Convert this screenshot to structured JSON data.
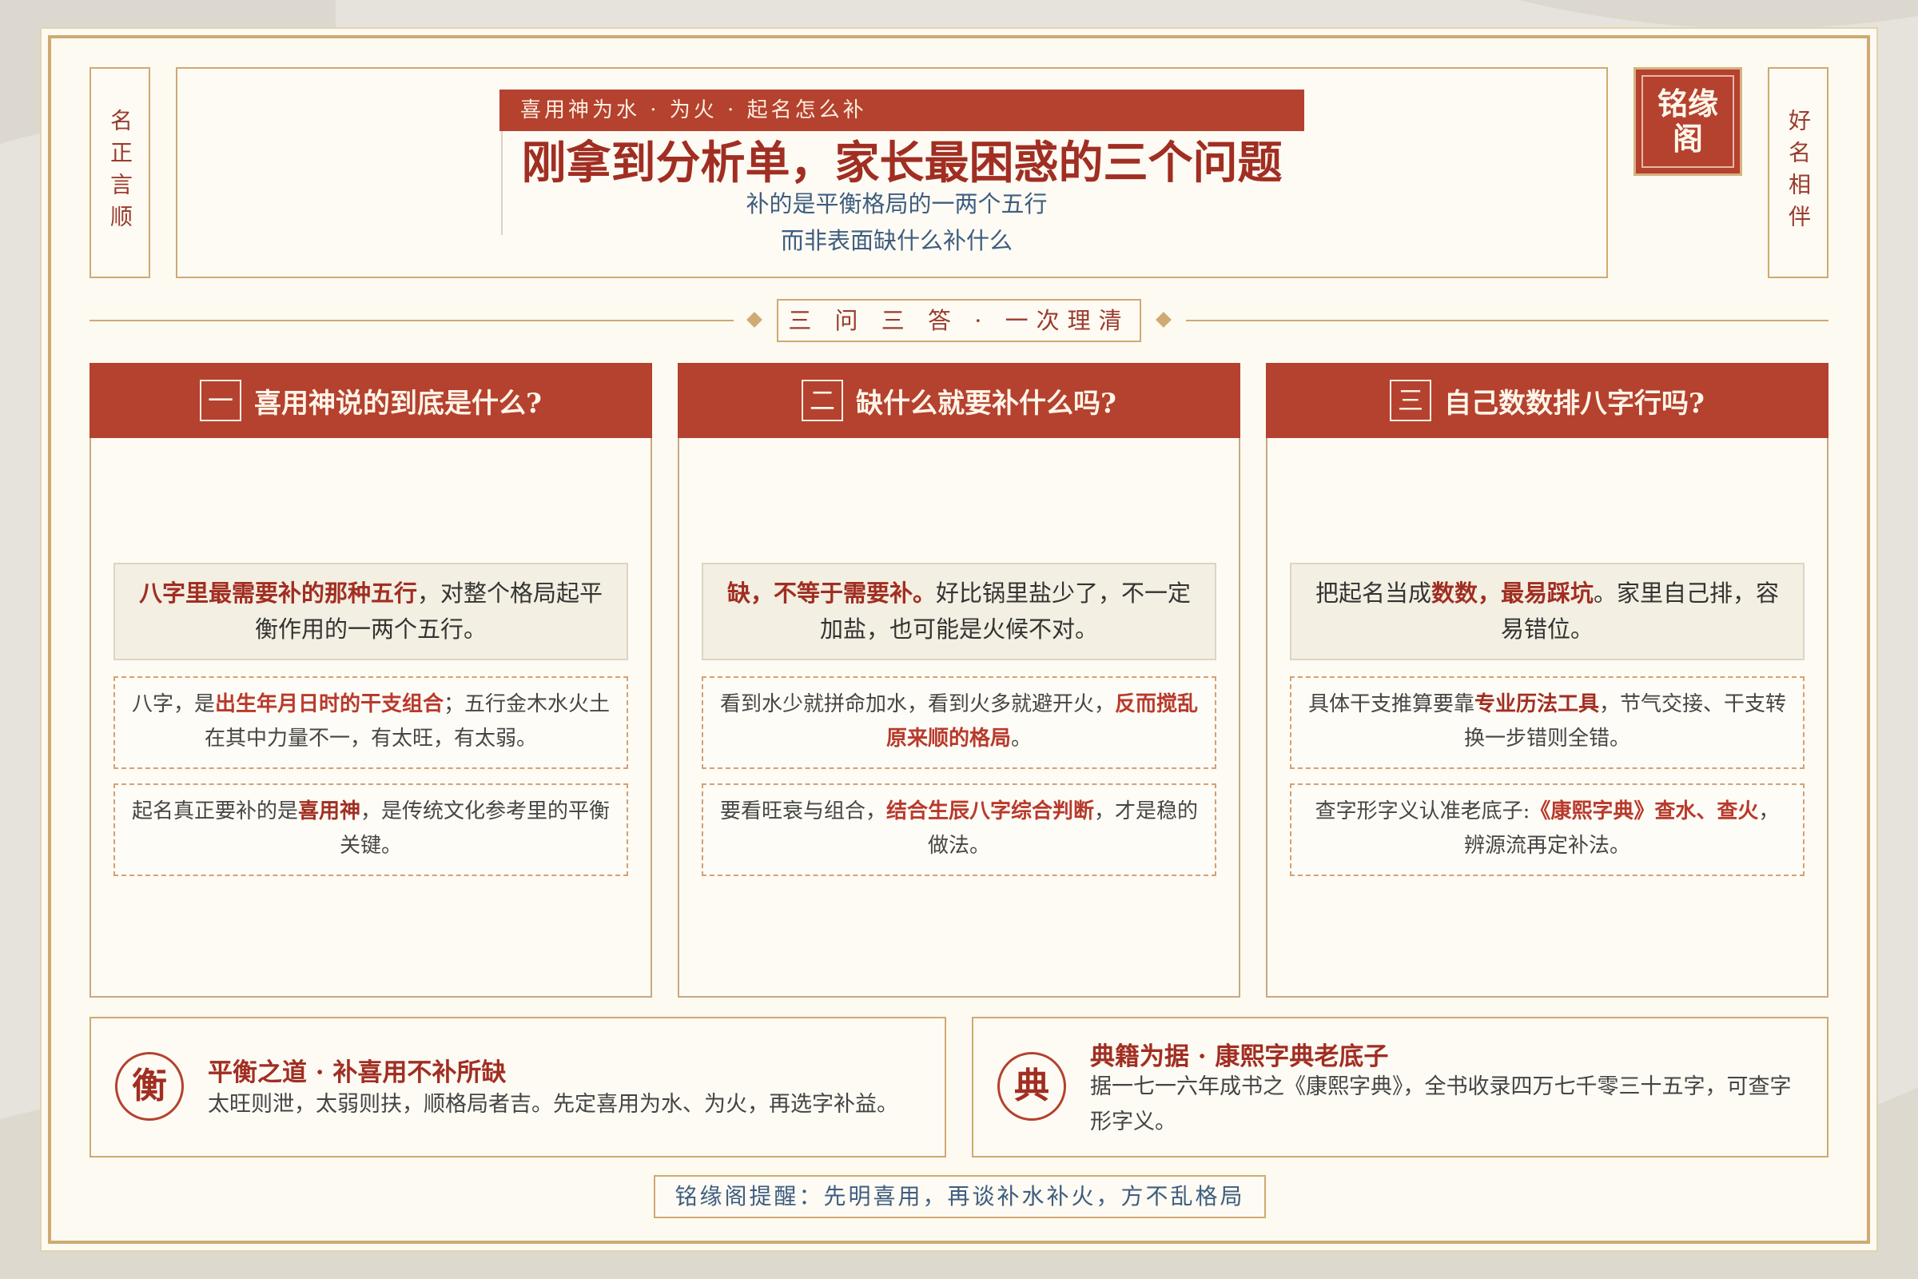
{
  "side": {
    "left": "名正言顺",
    "right": "好名相伴"
  },
  "header": {
    "tag": "喜用神为水 · 为火 · 起名怎么补",
    "title": "刚拿到分析单，家长最困惑的三个问题",
    "subtitle_line1": "补的是平衡格局的一两个五行",
    "subtitle_line2": "而非表面缺什么补什么"
  },
  "logo": {
    "line1": "铭缘",
    "line2": "阁"
  },
  "divider": {
    "label": "三 问 三 答 · 一次理清"
  },
  "cards": [
    {
      "num": "一",
      "title": "喜用神说的到底是什么?",
      "key": {
        "a": "八字里最需要补的那种五行",
        "b": "，对整个格局起平衡作用的一两个五行。"
      },
      "note1": {
        "a": "八字，是",
        "b": "出生年月日时的干支组合",
        "c": "；五行金木水火土在其中力量不一，有太旺，有太弱。"
      },
      "note2": {
        "a": "起名真正要补的是",
        "b": "喜用神",
        "c": "，是传统文化参考里的平衡关键。"
      }
    },
    {
      "num": "二",
      "title": "缺什么就要补什么吗?",
      "key": {
        "a": "缺，不等于需要补。",
        "b": "好比锅里盐少了，不一定加盐，也可能是火候不对。"
      },
      "note1": {
        "a": "看到水少就拼命加水，看到火多就避开火，",
        "b": "反而搅乱原来顺的格局",
        "c": "。"
      },
      "note2": {
        "a": "要看旺衰与组合，",
        "b": "结合生辰八字综合判断",
        "c": "，才是稳的做法。"
      }
    },
    {
      "num": "三",
      "title": "自己数数排八字行吗?",
      "key": {
        "a": "把起名当成",
        "b": "数数，最易踩坑",
        "c": "。家里自己排，容易错位。"
      },
      "note1": {
        "a": "具体干支推算要靠",
        "b": "专业历法工具",
        "c": "，节气交接、干支转换一步错则全错。"
      },
      "note2": {
        "a": "查字形字义认准老底子:",
        "b": "《康熙字典》查水、查火",
        "c": "，辨源流再定补法。"
      }
    }
  ],
  "info": {
    "left": {
      "seal": "衡",
      "title": "平衡之道 · 补喜用不补所缺",
      "text": "太旺则泄，太弱则扶，顺格局者吉。先定喜用为水、为火，再选字补益。"
    },
    "right": {
      "seal": "典",
      "title": "典籍为据 · 康熙字典老底子",
      "text": "据一七一六年成书之《康熙字典》，全书收录四万七千零三十五字，可查字形字义。"
    }
  },
  "footer": "铭缘阁提醒：先明喜用，再谈补水补火，方不乱格局",
  "colors": {
    "primary": "#b5412f",
    "accent": "#cfaa72",
    "paper": "#fcfaf1",
    "ink_blue": "#3f5d80"
  }
}
